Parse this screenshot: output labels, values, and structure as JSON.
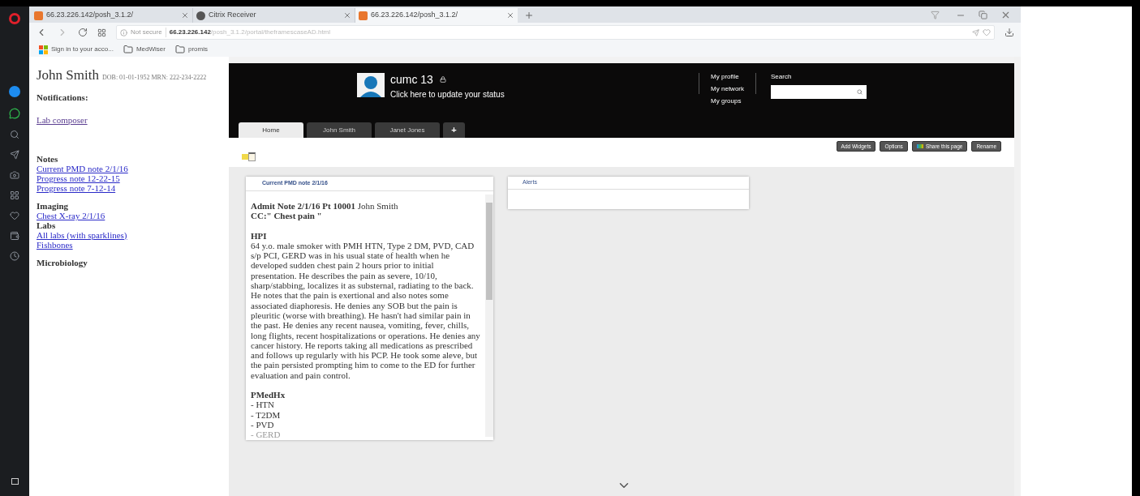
{
  "browser": {
    "tabs": [
      {
        "title": "66.23.226.142/posh_3.1.2/",
        "kind": "site",
        "selected": false
      },
      {
        "title": "Citrix Receiver",
        "kind": "citrix",
        "selected": false
      },
      {
        "title": "66.23.226.142/posh_3.1.2/",
        "kind": "site",
        "selected": true
      }
    ],
    "address": {
      "security": "Not secure",
      "host": "66.23.226.142",
      "path": "/posh_3.1.2/portal/theframescaseAD.html"
    },
    "bookmarks": [
      {
        "label": "Sign in to your acco...",
        "kind": "windows"
      },
      {
        "label": "MedWiser",
        "kind": "folder"
      },
      {
        "label": "promis",
        "kind": "folder"
      }
    ]
  },
  "patient": {
    "name": "John Smith",
    "details": "DOB: 01-01-1952 MRN: 222-234-2222",
    "notifications_heading": "Notifications:",
    "notification_links": [
      "Lab composer"
    ],
    "sections": [
      {
        "heading": "Notes",
        "links": [
          "Current PMD note 2/1/16",
          "Progress note 12-22-15",
          "Progress note 7-12-14"
        ]
      },
      {
        "heading": "Imaging",
        "links": [
          "Chest X-ray 2/1/16"
        ]
      },
      {
        "heading": "Labs",
        "links": [
          "All labs (with sparklines)",
          "Fishbones"
        ]
      },
      {
        "heading": "Microbiology"
      }
    ]
  },
  "portal": {
    "user": "cumc 13",
    "status_prompt": "Click here to update your status",
    "nav_links": [
      "My profile",
      "My network",
      "My groups"
    ],
    "search_label": "Search",
    "tabs": [
      {
        "label": "Home",
        "selected": true
      },
      {
        "label": "John Smith",
        "selected": false
      },
      {
        "label": "Janet Jones",
        "selected": false
      }
    ],
    "add_tab": "+",
    "toolbar_buttons": [
      {
        "label": "Add Widgets",
        "kind": "plain"
      },
      {
        "label": "Options",
        "kind": "plain"
      },
      {
        "label": "Share this page",
        "kind": "share"
      },
      {
        "label": "Rename",
        "kind": "plain"
      }
    ],
    "widgets": [
      {
        "title": "Current PMD note 2/1/16",
        "kind": "note",
        "note": {
          "admit": "**Admit Note 2/1/16 Pt 10001** John Smith",
          "cc": "CC:\" Chest pain \"",
          "hpi_heading": "HPI",
          "hpi": "64 y.o. male smoker with PMH HTN, Type 2 DM, PVD, CAD s/p PCI, GERD was in his usual state of health when he developed sudden chest pain 2 hours prior to initial presentation. He describes the pain as severe, 10/10, sharp/stabbing, localizes it as substernal, radiating to the back. He notes that the pain is exertional and also notes some associated diaphoresis. He denies any SOB but the pain is pleuritic (worse with breathing). He hasn't had similar pain in the past. He denies any recent nausea, vomiting, fever, chills, long flights, recent hospitalizations or operations. He denies any cancer history. He reports taking all medications as prescribed and follows up regularly with his PCP. He took some aleve, but the pain persisted prompting him to come to the ED for further evaluation and pain control.",
          "pmh_heading": "PMedHx",
          "pmh": [
            "- HTN",
            "- T2DM",
            "- PVD",
            "- GERD"
          ]
        }
      },
      {
        "title": "Alerts",
        "kind": "empty"
      }
    ]
  }
}
